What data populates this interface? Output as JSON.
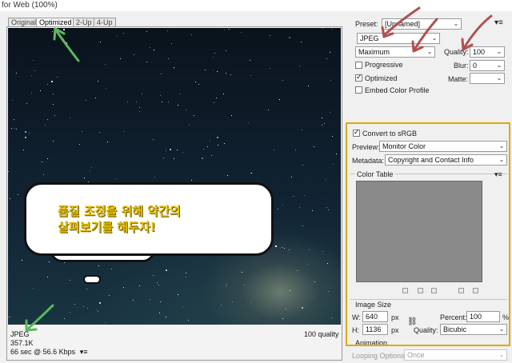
{
  "window": {
    "title": "for Web (100%)"
  },
  "view_tabs": [
    {
      "label": "Original"
    },
    {
      "label": "Optimized"
    },
    {
      "label": "2-Up"
    },
    {
      "label": "4-Up"
    }
  ],
  "overlay": {
    "line1": "품질 조정을 위해 약간의",
    "line2": "살펴보기를 해두자!"
  },
  "preview_info": {
    "format": "JPEG",
    "size": "357.1K",
    "download": "66 sec @ 56.6 Kbps",
    "quality": "100 quality"
  },
  "settings": {
    "preset_label": "Preset:",
    "preset_value": "[Unnamed]",
    "format_value": "JPEG",
    "compression_value": "Maximum",
    "quality_label": "Quality:",
    "quality_value": "100",
    "blur_label": "Blur:",
    "blur_value": "0",
    "matte_label": "Matte:",
    "progressive_label": "Progressive",
    "progressive_checked": false,
    "optimized_label": "Optimized",
    "optimized_checked": true,
    "embed_label": "Embed Color Profile",
    "embed_checked": false
  },
  "color": {
    "convert_label": "Convert to sRGB",
    "convert_checked": true,
    "preview_label": "Preview:",
    "preview_value": "Monitor Color",
    "metadata_label": "Metadata:",
    "metadata_value": "Copyright and Contact Info",
    "color_table_label": "Color Table"
  },
  "image_size": {
    "section_label": "Image Size",
    "w_label": "W:",
    "w_value": "640",
    "h_label": "H:",
    "h_value": "1136",
    "unit": "px",
    "percent_label": "Percent:",
    "percent_value": "100",
    "percent_unit": "%",
    "quality_label": "Quality:",
    "quality_value": "Bicubic",
    "animation_label": "Animation"
  },
  "looping": {
    "label": "Looping Options:",
    "value": "Once"
  },
  "colors": {
    "highlight": "#d9ad00",
    "arrow_red": "#b05050",
    "arrow_green": "#5cb85c",
    "text_yellow": "#e6c000"
  }
}
